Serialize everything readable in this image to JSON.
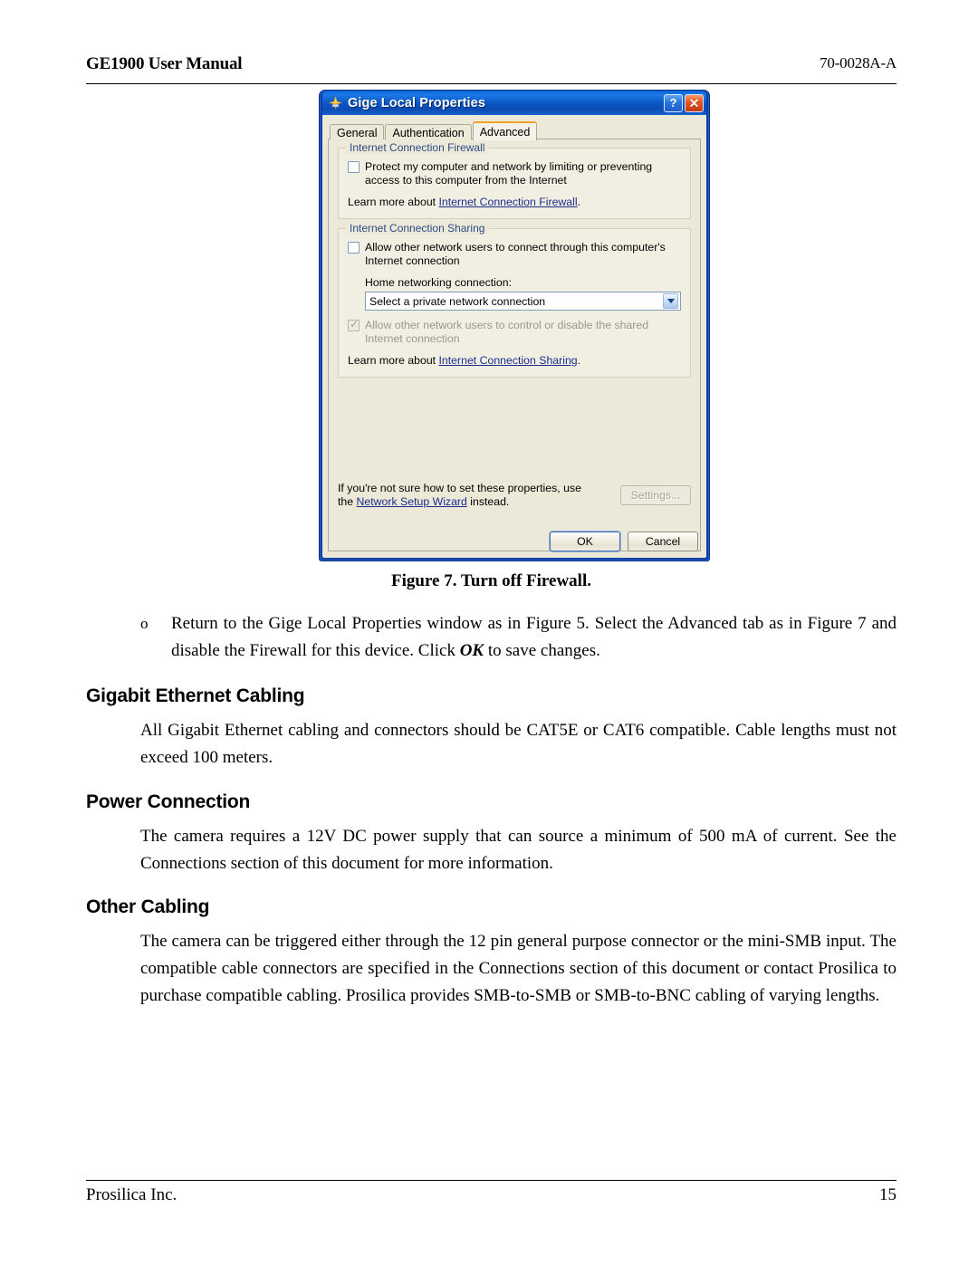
{
  "header": {
    "left": "GE1900 User Manual",
    "right": "70-0028A-A"
  },
  "dialog": {
    "title": "Gige Local Properties",
    "title_icon": "network-connection-icon",
    "help_button": "?",
    "close_button": "✕",
    "tabs": [
      {
        "label": "General",
        "active": false
      },
      {
        "label": "Authentication",
        "active": false
      },
      {
        "label": "Advanced",
        "active": true
      }
    ],
    "firewall_group": {
      "legend": "Internet Connection Firewall",
      "checkbox_label": "Protect my computer and network by limiting or preventing access to this computer from the Internet",
      "checkbox_checked": false,
      "learn_more_prefix": "Learn more about ",
      "learn_more_link": "Internet Connection Firewall",
      "learn_more_suffix": "."
    },
    "sharing_group": {
      "legend": "Internet Connection Sharing",
      "checkbox_label": "Allow other network users to connect through this computer's Internet connection",
      "checkbox_checked": false,
      "home_networking_label": "Home networking connection:",
      "combo_value": "Select a private network connection",
      "combo_icon": "chevron-down-icon",
      "control_checkbox_label": "Allow other network users to control or disable the shared Internet connection",
      "control_checkbox_checked": true,
      "control_checkbox_disabled": true,
      "learn_more_prefix": "Learn more about ",
      "learn_more_link": "Internet Connection Sharing",
      "learn_more_suffix": "."
    },
    "footer_note": {
      "line1": "If you're not sure how to set these properties, use",
      "line2_prefix": "the ",
      "line2_link": "Network Setup Wizard",
      "line2_suffix": " instead."
    },
    "settings_button": "Settings...",
    "settings_disabled": true,
    "ok_button": "OK",
    "cancel_button": "Cancel",
    "colors": {
      "titlebar_blue": "#0b56c6",
      "dialog_face": "#ece9d8",
      "link_blue": "#1b2d8c",
      "legend_blue": "#2d4b86",
      "active_tab_accent": "#f0a22c",
      "close_red": "#e8561f"
    }
  },
  "figure_caption": "Figure 7. Turn off Firewall.",
  "bullet": {
    "marker": "o",
    "text_part1": "Return to the Gige Local Properties window as in Figure 5.  Select the Advanced tab as in Figure 7 and disable the Firewall for this device.  Click ",
    "text_emphasis": "OK",
    "text_part2": " to save changes."
  },
  "sections": [
    {
      "heading": "Gigabit Ethernet Cabling",
      "body": "All Gigabit Ethernet cabling and connectors should be CAT5E or CAT6 compatible.  Cable lengths must not exceed 100 meters."
    },
    {
      "heading": "Power Connection",
      "body": "The camera requires a 12V DC power supply that can source a minimum of 500 mA of current.  See the Connections section of this document for more information."
    },
    {
      "heading": "Other Cabling",
      "body": "The camera can be triggered either through the 12 pin general purpose connector or the mini-SMB input.  The compatible cable connectors are specified in the Connections section of this document or contact Prosilica to purchase compatible cabling.  Prosilica provides SMB-to-SMB or SMB-to-BNC cabling of varying lengths."
    }
  ],
  "footer": {
    "left": "Prosilica Inc.",
    "page_number": "15"
  }
}
